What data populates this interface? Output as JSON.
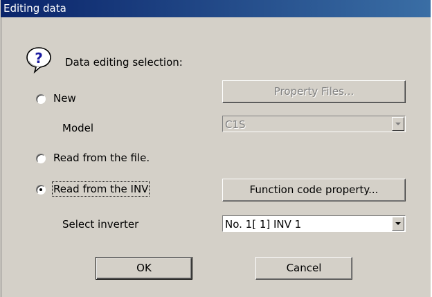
{
  "window": {
    "title": "Editing data"
  },
  "header": {
    "prompt": "Data editing selection:",
    "icon": "question-icon"
  },
  "options": {
    "new_label": "New",
    "model_label": "Model",
    "read_file_label": "Read from the file.",
    "read_inv_label": "Read from the INV",
    "select_inverter_label": "Select inverter",
    "selected": "Read from the INV"
  },
  "buttons": {
    "property_files": "Property Files...",
    "function_code_property": "Function code property...",
    "ok": "OK",
    "cancel": "Cancel"
  },
  "fields": {
    "model_value": "C1S",
    "inverter_value": "No. 1[  1] INV 1"
  },
  "colors": {
    "titlebar": "#0a246a",
    "dialog_bg": "#d4d0c8",
    "disabled_text": "#808080"
  }
}
